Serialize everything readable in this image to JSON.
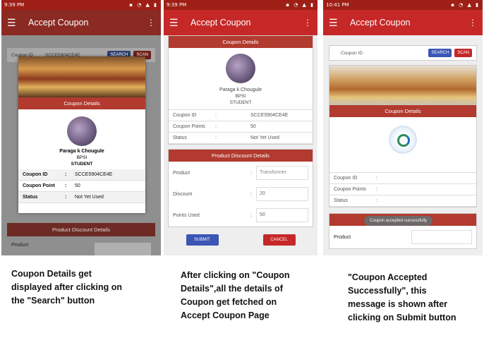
{
  "screen1": {
    "time": "9:39 PM",
    "title": "Accept Coupon",
    "coupon_id_label": "Coupon ID",
    "coupon_id_value": "SCCE5904CE4E",
    "search_btn": "SEARCH",
    "scan_btn": "SCAN",
    "dialog_header": "Coupon Details",
    "name": "Paraga k Chougule",
    "dept": "BPSI",
    "role": "STUDENT",
    "rows": [
      {
        "k": "Coupon ID",
        "c": ":",
        "v": "SCCE5904CE4E"
      },
      {
        "k": "Coupon Point",
        "c": ":",
        "v": "50"
      },
      {
        "k": "Status",
        "c": ":",
        "v": "Not Yet Used"
      }
    ],
    "bottom_bar": "Product Discount Details",
    "product_label": "Product"
  },
  "screen2": {
    "time": "9:39 PM",
    "title": "Accept Coupon",
    "header": "Coupon Details",
    "name": "Paraga k Chougule",
    "dept": "BPSI",
    "role": "STUDENT",
    "rows": [
      {
        "k": "Coupon ID",
        "c": ":",
        "v": "SCCE5904CE4E"
      },
      {
        "k": "Coupon Points",
        "c": ":",
        "v": "50"
      },
      {
        "k": "Status",
        "c": ":",
        "v": "Not Yet Used"
      }
    ],
    "discount_header": "Product Discount Details",
    "form": [
      {
        "k": "Product",
        "v": "Transformer"
      },
      {
        "k": "Discount",
        "v": "20"
      },
      {
        "k": "Points Used",
        "v": "50"
      }
    ],
    "submit": "SUBMIT",
    "cancel": "CANCEL"
  },
  "screen3": {
    "time": "10:41 PM",
    "title": "Accept Coupon",
    "coupon_id_label": "Coupon ID",
    "search_btn": "SEARCH",
    "scan_btn": "SCAN",
    "header": "Coupon Details",
    "rows": [
      {
        "k": "Coupon ID",
        "c": ":"
      },
      {
        "k": "Coupon Points",
        "c": ":"
      },
      {
        "k": "Status",
        "c": ":"
      }
    ],
    "toast": "Coupon accepted successfully",
    "bottom_bar": "Product Discount Details",
    "product_label": "Product"
  },
  "captions": {
    "c1": "Coupon Details get displayed after clicking on the \"Search\" button",
    "c2": "After clicking on \"Coupon Details\",all the details of Coupon get fetched on Accept Coupon Page",
    "c3": "\"Coupon Accepted Successfully\", this message is shown after clicking on Submit button"
  }
}
